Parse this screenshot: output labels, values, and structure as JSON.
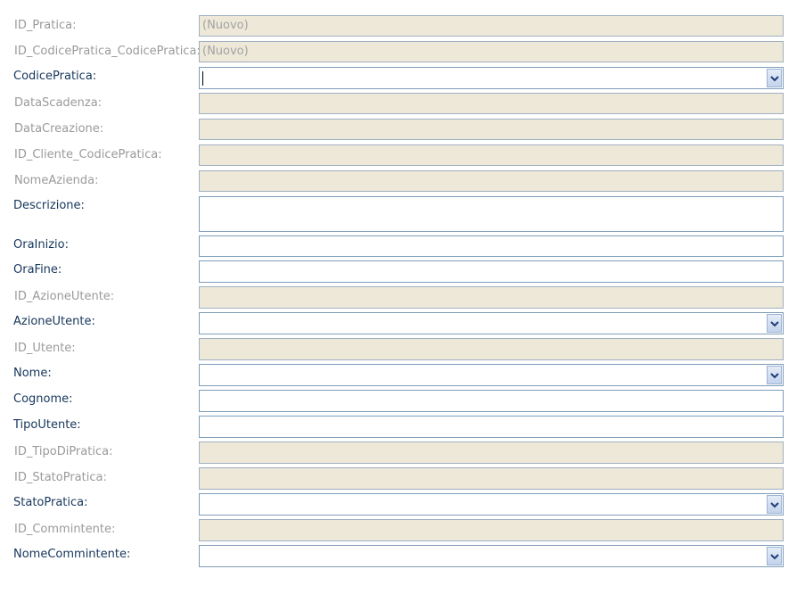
{
  "fields": {
    "id_pratica": {
      "label": "ID_Pratica:",
      "value": "(Nuovo)"
    },
    "id_codicepratica": {
      "label": "ID_CodicePratica_CodicePratica:",
      "value": "(Nuovo)"
    },
    "codicepratica": {
      "label": "CodicePratica:",
      "value": ""
    },
    "datascadenza": {
      "label": "DataScadenza:",
      "value": ""
    },
    "datacreazione": {
      "label": "DataCreazione:",
      "value": ""
    },
    "id_cliente": {
      "label": "ID_Cliente_CodicePratica:",
      "value": ""
    },
    "nomeazienda": {
      "label": "NomeAzienda:",
      "value": ""
    },
    "descrizione": {
      "label": "Descrizione:",
      "value": ""
    },
    "orainizio": {
      "label": "OraInizio:",
      "value": ""
    },
    "orafine": {
      "label": "OraFine:",
      "value": ""
    },
    "id_azioneutente": {
      "label": "ID_AzioneUtente:",
      "value": ""
    },
    "azioneutente": {
      "label": "AzioneUtente:",
      "value": ""
    },
    "id_utente": {
      "label": "ID_Utente:",
      "value": ""
    },
    "nome": {
      "label": "Nome:",
      "value": ""
    },
    "cognome": {
      "label": "Cognome:",
      "value": ""
    },
    "tipoutente": {
      "label": "TipoUtente:",
      "value": ""
    },
    "id_tipodipratica": {
      "label": "ID_TipoDiPratica:",
      "value": ""
    },
    "id_statopratica": {
      "label": "ID_StatoPratica:",
      "value": ""
    },
    "statopratica": {
      "label": "StatoPratica:",
      "value": ""
    },
    "id_commintente": {
      "label": "ID_Commintente:",
      "value": ""
    },
    "nomecommintente": {
      "label": "NomeCommintente:",
      "value": ""
    }
  },
  "icons": {
    "dropdown": "chevron-down-icon"
  },
  "colors": {
    "active_label": "#16365c",
    "locked_label": "#9a9a9a",
    "locked_field_bg": "#ede8d8",
    "field_border": "#7f9db9"
  }
}
